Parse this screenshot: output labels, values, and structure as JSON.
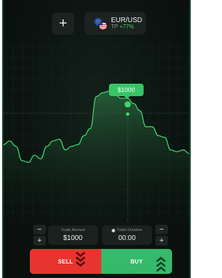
{
  "header": {
    "add_label": "+",
    "pair": "EUR/USD",
    "sub_prefix": "TP",
    "sub_value": "+77%"
  },
  "chart": {
    "price_label": "$1000",
    "line_color": "#3fd46b",
    "points": [
      0.57,
      0.55,
      0.58,
      0.66,
      0.67,
      0.63,
      0.65,
      0.58,
      0.55,
      0.54,
      0.6,
      0.58,
      0.57,
      0.52,
      0.48,
      0.3,
      0.28,
      0.27,
      0.29,
      0.31,
      0.31,
      0.34,
      0.38,
      0.47,
      0.47,
      0.52,
      0.53,
      0.6,
      0.61,
      0.6,
      0.62
    ]
  },
  "controls": {
    "amount_label": "Trade Amount",
    "amount_value": "$1000",
    "duration_label": "Trade Duration",
    "duration_value": "00:00",
    "minus": "−",
    "plus": "+"
  },
  "actions": {
    "sell_label": "SELL",
    "buy_label": "BUY",
    "sell_color": "#e8342f",
    "buy_color": "#35b96a"
  }
}
